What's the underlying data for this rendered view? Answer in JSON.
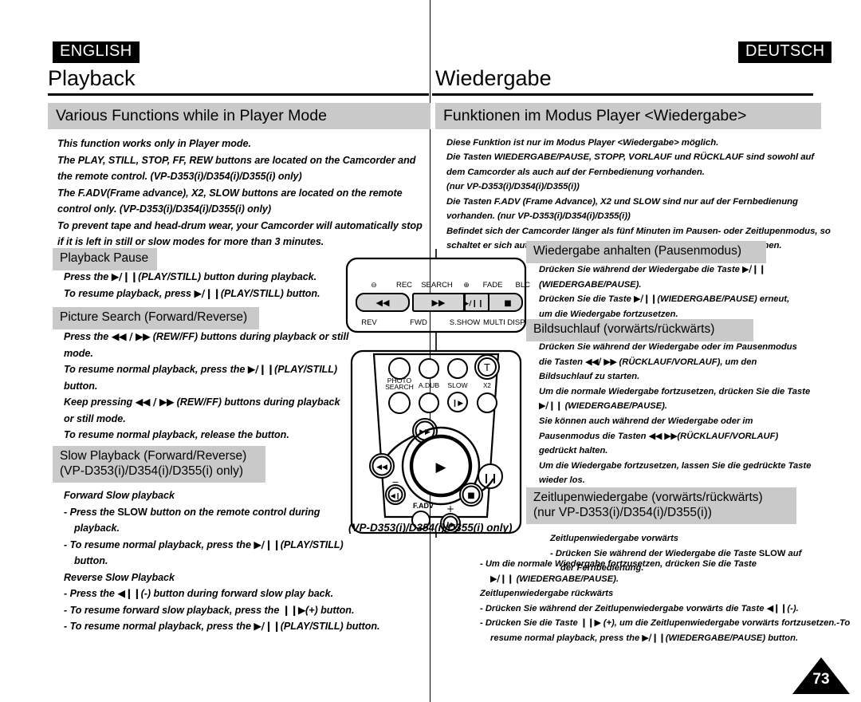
{
  "left": {
    "lang_tag": "ENGLISH",
    "chapter_title": "Playback",
    "section_title": "Various Functions while in Player Mode",
    "intro_lines": [
      "This function works only in Player mode.",
      "The PLAY, STILL, STOP, FF, REW  buttons are located on the Camcorder and",
      "the remote control. (VP-D353(i)/D354(i)/D355(i) only)",
      "The F.ADV(Frame advance), X2, SLOW buttons are located on the remote",
      "control only. (VP-D353(i)/D354(i)/D355(i) only)",
      "To prevent tape and head-drum wear, your Camcorder will automatically stop",
      "if it is left in still or slow modes for more than 3 minutes."
    ],
    "pause": {
      "title": "Playback Pause",
      "lines": [
        {
          "pre": "Press the",
          "glyph": "▶/❙❙",
          "post": "(PLAY/STILL) button during playback."
        },
        {
          "pre": "To resume playback, press",
          "glyph": "▶/❙❙",
          "post": "(PLAY/STILL) button."
        }
      ]
    },
    "search": {
      "title": "Picture Search (Forward/Reverse)",
      "lines": [
        {
          "pre": "Press the",
          "glyph": "◀◀ / ▶▶",
          "post": "(REW/FF) buttons during playback or still"
        },
        {
          "pre": "mode.",
          "glyph": "",
          "post": ""
        },
        {
          "pre": "To resume normal playback, press the",
          "glyph": "▶/❙❙",
          "post": "(PLAY/STILL)"
        },
        {
          "pre": "button.",
          "glyph": "",
          "post": ""
        },
        {
          "pre": "Keep pressing",
          "glyph": "◀◀ / ▶▶",
          "post": "(REW/FF) buttons during playback"
        },
        {
          "pre": "or still mode.",
          "glyph": "",
          "post": ""
        },
        {
          "pre": "To resume normal playback, release the button.",
          "glyph": "",
          "post": ""
        }
      ]
    },
    "slow": {
      "title_line1": "Slow Playback (Forward/Reverse)",
      "title_line2": "(VP-D353(i)/D354(i)/D355(i) only)",
      "forward_heading": "Forward Slow playback",
      "forward_bullets": [
        {
          "pre": "- Press the",
          "upright": "SLOW",
          "post": "button on the remote control during"
        },
        {
          "pre": "playback.",
          "upright": "",
          "post": "",
          "indent": true
        },
        {
          "pre": "- To resume normal playback, press the",
          "glyph": "▶/❙❙",
          "post": "(PLAY/STILL)"
        },
        {
          "pre": "button.",
          "upright": "",
          "post": "",
          "indent": true
        }
      ],
      "reverse_heading": "Reverse Slow Playback",
      "reverse_bullets": [
        {
          "pre": "- Press the",
          "glyph": "◀❙❙",
          "post": "(-) button during forward slow play back."
        },
        {
          "pre": "- To resume forward slow playback, press the",
          "glyph": "❙❙▶",
          "post": "(+) button."
        },
        {
          "pre": "- To resume normal playback, press the",
          "glyph": "▶/❙❙",
          "post": "(PLAY/STILL) button."
        }
      ]
    }
  },
  "right": {
    "lang_tag": "DEUTSCH",
    "chapter_title": "Wiedergabe",
    "section_title": "Funktionen im Modus Player <Wiedergabe>",
    "intro_lines": [
      "Diese Funktion ist nur im Modus Player <Wiedergabe> möglich.",
      "Die Tasten WIEDERGABE/PAUSE, STOPP, VORLAUF und RÜCKLAUF sind sowohl auf",
      "dem Camcorder als auch auf der Fernbedienung vorhanden.",
      "(nur VP-D353(i)/D354(i)/D355(i))",
      "Die Tasten F.ADV (Frame Advance), X2 und SLOW sind nur auf der Fernbedienung",
      "vorhanden. (nur VP-D353(i)/D354(i)/D355(i))",
      "Befindet sich der Camcorder länger als fünf Minuten im Pausen- oder Zeitlupenmodus, so",
      "schaltet er sich automatisch ab, um das Band und die Videoköpfe zu schonen."
    ],
    "pause": {
      "title": "Wiedergabe anhalten (Pausenmodus)",
      "lines": [
        {
          "pre": "Drücken Sie während der Wiedergabe die Taste",
          "glyph": "▶/❙❙",
          "post": ""
        },
        {
          "pre": "(WIEDERGABE/PAUSE).",
          "glyph": "",
          "post": ""
        },
        {
          "pre": "Drücken Sie die Taste",
          "glyph": "▶/❙❙",
          "post": "(WIEDERGABE/PAUSE) erneut,"
        },
        {
          "pre": "um die Wiedergabe fortzusetzen.",
          "glyph": "",
          "post": ""
        }
      ]
    },
    "search": {
      "title": "Bildsuchlauf (vorwärts/rückwärts)",
      "lines": [
        {
          "pre": "Drücken Sie während der Wiedergabe oder im Pausenmodus",
          "glyph": "",
          "post": ""
        },
        {
          "pre": "die Tasten",
          "glyph": "◀◀/ ▶▶",
          "post": "(RÜCKLAUF/VORLAUF), um den"
        },
        {
          "pre": "Bildsuchlauf zu starten.",
          "glyph": "",
          "post": ""
        },
        {
          "pre": "Um die normale Wiedergabe fortzusetzen, drücken Sie die Taste",
          "glyph": "",
          "post": ""
        },
        {
          "pre": "",
          "glyph": "▶/❙❙",
          "post": "(WIEDERGABE/PAUSE)."
        },
        {
          "pre": "Sie können auch während der Wiedergabe oder im",
          "glyph": "",
          "post": ""
        },
        {
          "pre": "Pausenmodus die Tasten",
          "glyph": "◀◀  ▶▶",
          "post": "(RÜCKLAUF/VORLAUF)"
        },
        {
          "pre": "gedrückt halten.",
          "glyph": "",
          "post": ""
        },
        {
          "pre": "Um die Wiedergabe fortzusetzen, lassen Sie die gedrückte Taste",
          "glyph": "",
          "post": ""
        },
        {
          "pre": "wieder los.",
          "glyph": "",
          "post": ""
        }
      ]
    },
    "slow": {
      "title_line1": "Zeitlupenwiedergabe (vorwärts/rückwärts)",
      "title_line2": "(nur VP-D353(i)/D354(i)/D355(i))",
      "forward_heading": "Zeitlupenwiedergabe vorwärts",
      "forward_bullets": [
        {
          "pre": "- Drücken Sie während der Wiedergabe die Taste",
          "upright": "SLOW",
          "post": "auf"
        },
        {
          "pre": "der Fernbedienung.",
          "upright": "",
          "post": "",
          "indent": true
        }
      ],
      "tail_lines": [
        {
          "pre": "- Um die normale Wiedergabe fortzusetzen, drücken Sie die Taste",
          "glyph": "",
          "post": ""
        },
        {
          "pre": "",
          "glyph": "▶/❙❙",
          "post": "(WIEDERGABE/PAUSE)."
        },
        {
          "pre": "Zeitlupenwiedergabe rückwärts",
          "glyph": "",
          "post": ""
        },
        {
          "pre": "- Drücken Sie während der Zeitlupenwiedergabe vorwärts die Taste",
          "glyph": "◀❙❙",
          "post": "(-)."
        },
        {
          "pre": "- Drücken Sie die Taste",
          "glyph": "❙❙▶",
          "post": "(+), um die Zeitlupenwiedergabe vorwärts fortzusetzen.-To"
        },
        {
          "pre": "resume normal playback, press the",
          "glyph": "▶/❙❙",
          "post": "(WIEDERGABE/PAUSE) button."
        }
      ]
    }
  },
  "remote": {
    "caption": "(VP-D353(i)/D354(i)/D355(i) only)",
    "top_panel": {
      "rec_search_label": "REC SEARCH",
      "minus_symbol": "⊖",
      "plus_symbol": "⊕",
      "fade_label": "FADE",
      "blc_label": "BLC",
      "btn_rev_glyph": "◀◀",
      "btn_fwd_glyph": "▶▶",
      "btn_sshow_glyph": "▶/❙❙",
      "btn_multidisp_glyph": "■",
      "under_labels": [
        "REV",
        "FWD",
        "S.SHOW",
        "MULTI DISP."
      ]
    },
    "body_panel": {
      "photo_search_line1": "PHOTO",
      "photo_search_line2": "SEARCH",
      "adub_label": "A.DUB",
      "slow_label": "SLOW",
      "x2_label": "X2",
      "tele_label": "T",
      "fadv_label": "F.ADV",
      "zoom_minus": "−",
      "zoom_plus": "+",
      "slow_btn_glyph": "❙▶",
      "rew_glyph": "◀◀",
      "ff_glyph": "▶▶",
      "play_glyph": "▶",
      "pause_glyph": "❙❙",
      "stop_glyph": "■",
      "wide_glyph": "◀❙",
      "tele_zoom_glyph": "❙▶"
    }
  },
  "page_number": "73",
  "colors": {
    "band_grey": "#c9c9c9",
    "tag_black": "#000000",
    "button_grey": "#d6d6d6",
    "paper": "#ffffff"
  }
}
